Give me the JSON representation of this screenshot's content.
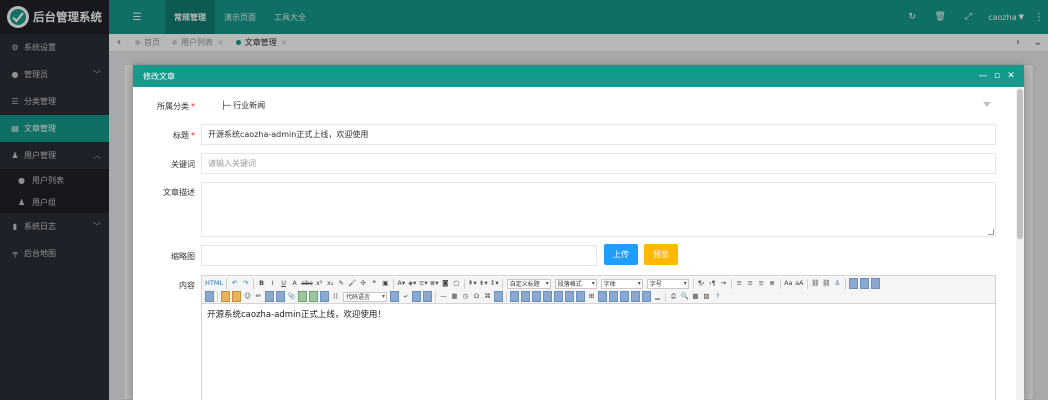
{
  "app": {
    "title": "后台管理系统"
  },
  "sidebar": {
    "items": [
      {
        "label": "系统设置",
        "icon": "gears-icon"
      },
      {
        "label": "管理员",
        "icon": "user-circle-icon",
        "has_children": true
      },
      {
        "label": "分类管理",
        "icon": "list-icon"
      },
      {
        "label": "文章管理",
        "icon": "article-icon",
        "active": true
      },
      {
        "label": "用户管理",
        "icon": "user-icon",
        "expanded": true
      },
      {
        "label": "系统日志",
        "icon": "file-icon",
        "has_children": true
      },
      {
        "label": "后台地图",
        "icon": "sitemap-icon"
      }
    ],
    "sub_items": [
      {
        "label": "用户列表",
        "icon": "user-circle-icon"
      },
      {
        "label": "用户组",
        "icon": "users-icon"
      }
    ]
  },
  "header": {
    "nav": [
      {
        "label": "常规管理",
        "active": true
      },
      {
        "label": "演示页面"
      },
      {
        "label": "工具大全"
      }
    ],
    "user": "caozha"
  },
  "tabs": [
    {
      "label": "首页"
    },
    {
      "label": "用户列表"
    },
    {
      "label": "文章管理",
      "active": true
    }
  ],
  "modal": {
    "title": "修改文章",
    "form": {
      "category_label": "所属分类",
      "category_value": "├─ 行业新闻",
      "title_label": "标题",
      "title_value": "开源系统caozha-admin正式上线，欢迎使用",
      "keywords_label": "关键词",
      "keywords_placeholder": "请输入关键词",
      "desc_label": "文章描述",
      "thumb_label": "缩略图",
      "upload_label": "上传",
      "preview_label": "预览",
      "content_label": "内容",
      "content_value": "开源系统caozha-admin正式上线，欢迎使用！"
    },
    "editor": {
      "custom_title": "自定义标题",
      "paragraph_format": "段落格式",
      "font_family": "字体",
      "font_size": "字号",
      "code_lang": "代码语言"
    }
  },
  "colors": {
    "accent": "#169a8c",
    "sidebar": "#2b2f3a",
    "upload": "#1e9fff",
    "preview": "#ffb800"
  }
}
